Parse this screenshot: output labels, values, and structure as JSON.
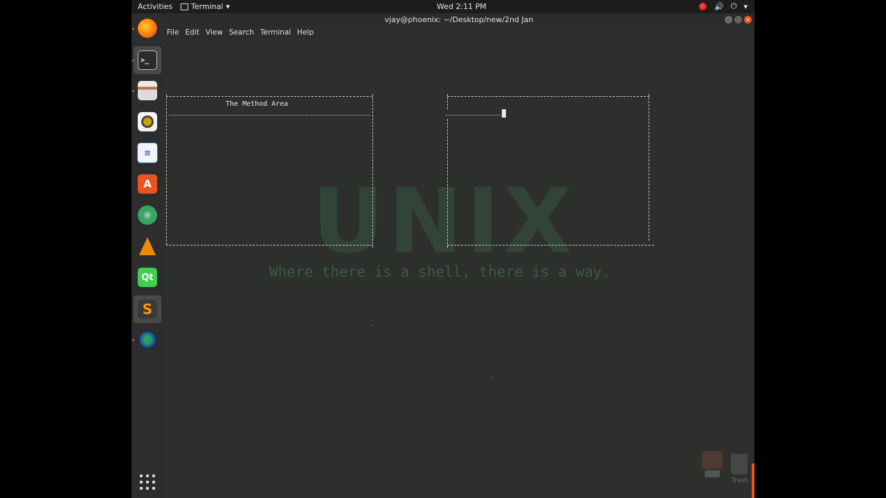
{
  "topbar": {
    "activities": "Activities",
    "app_name": "Terminal",
    "app_menu_arrow": "▾",
    "clock": "Wed  2:11 PM",
    "tray_icons": [
      "record-icon",
      "volume-icon",
      "power-icon",
      "chevron-down-icon"
    ]
  },
  "dock": {
    "items": [
      {
        "name": "firefox",
        "running": true
      },
      {
        "name": "terminal",
        "running": true,
        "active": true
      },
      {
        "name": "files",
        "running": true
      },
      {
        "name": "rhythmbox",
        "running": false
      },
      {
        "name": "libreoffice-writer",
        "running": false
      },
      {
        "name": "ubuntu-software",
        "running": false
      },
      {
        "name": "atom",
        "running": false
      },
      {
        "name": "vlc",
        "running": false
      },
      {
        "name": "qt-creator",
        "running": false
      },
      {
        "name": "sublime-text",
        "running": false
      },
      {
        "name": "camera-app",
        "running": true
      }
    ]
  },
  "window": {
    "title": "vjay@phoenix: ~/Desktop/new/2nd Jan",
    "menu": [
      "File",
      "Edit",
      "View",
      "Search",
      "Terminal",
      "Help"
    ]
  },
  "terminal": {
    "box1_label": "The Method Area",
    "box2_label": ""
  },
  "wallpaper": {
    "logo_text": "UNIX",
    "tagline": "Where there is a shell, there is a way."
  },
  "desktop": {
    "trash_label": "Trash"
  },
  "colors": {
    "accent": "#e95420",
    "terminal_bg": "#2d2f2d",
    "wallpaper_text": "#34473a"
  }
}
